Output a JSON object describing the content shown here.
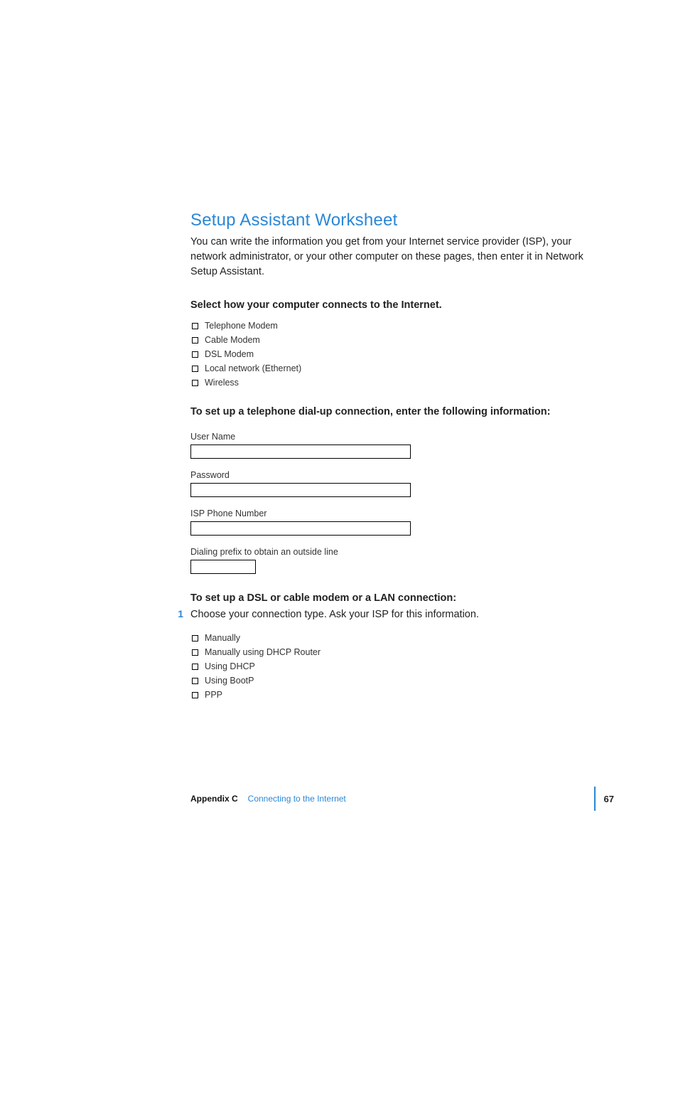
{
  "title": "Setup Assistant Worksheet",
  "intro": "You can write the information you get from your Internet service provider (ISP), your network administrator, or your other computer on these pages, then enter it in Network Setup Assistant.",
  "select_heading": "Select how your computer connects to the Internet.",
  "connection_options": [
    "Telephone Modem",
    "Cable Modem",
    "DSL Modem",
    "Local network (Ethernet)",
    "Wireless"
  ],
  "dialup_heading": "To set up a telephone dial-up connection, enter the following information:",
  "fields": {
    "user_name": "User Name",
    "password": "Password",
    "isp_phone": "ISP Phone Number",
    "dialing_prefix": "Dialing prefix to obtain an outside line"
  },
  "dsl_heading": "To set up a DSL or cable modem or a LAN connection:",
  "step1_num": "1",
  "step1_text": "Choose your connection type. Ask your ISP for this information.",
  "config_options": [
    "Manually",
    "Manually using DHCP Router",
    "Using DHCP",
    "Using BootP",
    "PPP"
  ],
  "footer": {
    "appendix": "Appendix C",
    "chapter": "Connecting to the Internet",
    "page": "67"
  }
}
